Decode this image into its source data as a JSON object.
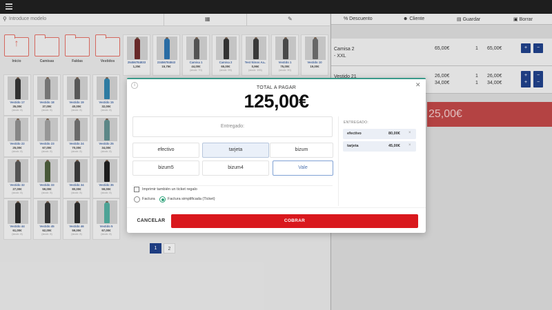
{
  "topbar": {
    "menu_icon": "hamburger-icon"
  },
  "search": {
    "placeholder": "Introduce modelo"
  },
  "folders": [
    {
      "label": "Inicio",
      "icon": "arrow-up-icon"
    },
    {
      "label": "Camisas",
      "icon": "folder-icon"
    },
    {
      "label": "Faldas",
      "icon": "folder-icon"
    },
    {
      "label": "Vestidos",
      "icon": "folder-icon"
    }
  ],
  "products_row1": [
    {
      "name": "25456784833",
      "price": "1,25€",
      "stock": ""
    },
    {
      "name": "23456784843",
      "price": "15,75€",
      "stock": ""
    },
    {
      "name": "Camisa 1",
      "price": "44,00€",
      "stock": "(stock: 70)"
    },
    {
      "name": "Camisa 2",
      "price": "65,00€",
      "stock": "(stock: 99)"
    },
    {
      "name": "Test Ninos Aa..",
      "price": "0,96€",
      "stock": "(stock: 195)"
    },
    {
      "name": "Vestido 1",
      "price": "75,00€",
      "stock": "(stock: 90)"
    },
    {
      "name": "Vestido 10",
      "price": "19,00€",
      "stock": ""
    }
  ],
  "products_grid": [
    {
      "name": "Vestido 17",
      "price": "35,00€",
      "stock": "(stock: 8)"
    },
    {
      "name": "Vestido 18",
      "price": "37,00€",
      "stock": "(stock: 8)"
    },
    {
      "name": "Vestido 19",
      "price": "40,00€",
      "stock": "(stock: 8)"
    },
    {
      "name": "Vestido 15",
      "price": "32,00€",
      "stock": "(stock: 8)"
    },
    {
      "name": "Vestido 22",
      "price": "25,00€",
      "stock": "(stock: 8)"
    },
    {
      "name": "Vestido 23",
      "price": "67,00€",
      "stock": "(stock: 8)"
    },
    {
      "name": "Vestido 24",
      "price": "70,00€",
      "stock": "(stock: 8)"
    },
    {
      "name": "Vestido 25",
      "price": "34,00€",
      "stock": "(stock: 8)"
    },
    {
      "name": "Vestido 32",
      "price": "27,00€",
      "stock": "(stock: 8)"
    },
    {
      "name": "Vestido 33",
      "price": "59,00€",
      "stock": "(stock: 8)"
    },
    {
      "name": "Vestido 34",
      "price": "80,00€",
      "stock": "(stock: 8)"
    },
    {
      "name": "Vestido 35",
      "price": "59,00€",
      "stock": "(stock: 8)"
    },
    {
      "name": "Vestido 44",
      "price": "61,00€",
      "stock": "(stock: 8)"
    },
    {
      "name": "Vestido 45",
      "price": "62,00€",
      "stock": "(stock: 8)"
    },
    {
      "name": "Vestido 46",
      "price": "59,00€",
      "stock": "(stock: 8)"
    },
    {
      "name": "Vestido 5",
      "price": "67,00€",
      "stock": "(stock: 8)"
    }
  ],
  "pagination": {
    "current": "1",
    "next": "2"
  },
  "cart_toolbar": {
    "descuento": "Descuento",
    "cliente": "Cliente",
    "guardar": "Guardar",
    "borrar": "Borrar"
  },
  "cart": [
    {
      "name": "Camisa 2\n- XXL",
      "price": "65,00€",
      "qty": "1",
      "total": "65,00€"
    },
    {
      "name": "Vestido 21\n- S",
      "price": "26,00€",
      "qty": "1",
      "total": "26,00€"
    },
    {
      "name": "",
      "price": "34,00€",
      "qty": "1",
      "total": "34,00€"
    }
  ],
  "cart_total": "25,00€",
  "modal": {
    "title": "TOTAL A PAGAR",
    "amount": "125,00€",
    "entregado_placeholder": "Entregado:",
    "payment_methods": [
      "efectivo",
      "tarjeta",
      "bizum",
      "bizum5",
      "bizum4",
      "Vale"
    ],
    "selected_method": "tarjeta",
    "print_gift_ticket": "Imprimir también un ticket regalo",
    "factura": "Factura",
    "factura_simplificada": "Factura simplificada (Ticket)",
    "entregado_title": "ENTREGADO:",
    "entregado": [
      {
        "method": "efectivo",
        "amount": "80,00€"
      },
      {
        "method": "tarjeta",
        "amount": "45,00€"
      }
    ],
    "cancel_label": "CANCELAR",
    "charge_label": "COBRAR"
  }
}
